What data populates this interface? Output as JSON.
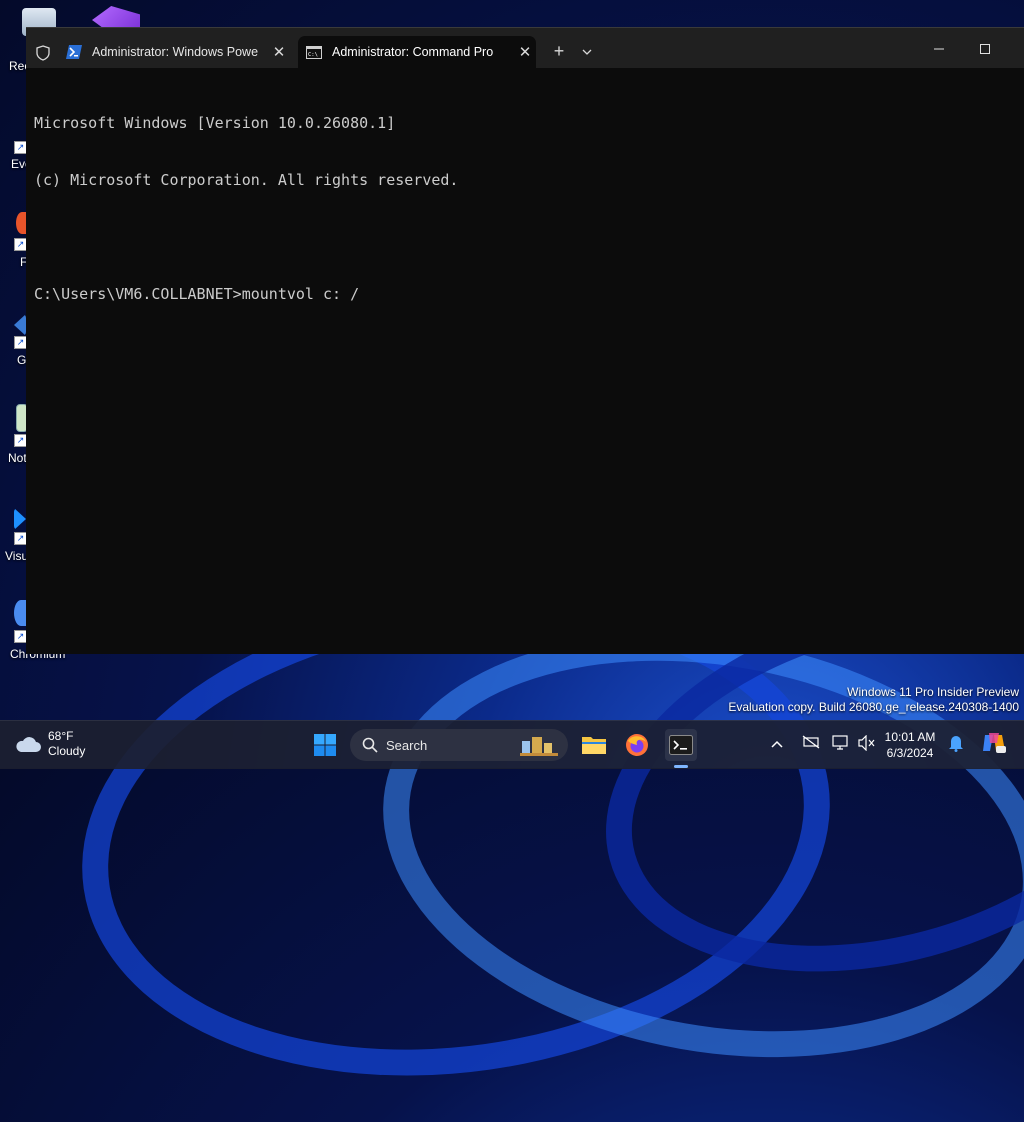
{
  "desktop": {
    "icons": [
      {
        "label": "Rec"
      },
      {
        "label": "Eve"
      },
      {
        "label": "F"
      },
      {
        "label": "G"
      },
      {
        "label": "Not"
      },
      {
        "label": "Visu"
      },
      {
        "label": "Chromium"
      }
    ],
    "watermark": {
      "line1": "Windows 11 Pro Insider Preview",
      "line2": "Evaluation copy. Build 26080.ge_release.240308-1400"
    }
  },
  "terminal": {
    "tabs": [
      {
        "label": "Administrator: Windows Powe",
        "icon": "powershell-icon",
        "active": false
      },
      {
        "label": "Administrator: Command Pro",
        "icon": "cmd-icon",
        "active": true
      }
    ],
    "new_tab": "+",
    "dropdown": "⌄",
    "minimize": "─",
    "maximize": "☐",
    "console_lines": [
      "Microsoft Windows [Version 10.0.26080.1]",
      "(c) Microsoft Corporation. All rights reserved.",
      "",
      "C:\\Users\\VM6.COLLABNET>mountvol c: /"
    ]
  },
  "taskbar": {
    "weather": {
      "temp": "68°F",
      "condition": "Cloudy"
    },
    "search_placeholder": "Search",
    "pinned": [
      "start-icon",
      "file-explorer-icon",
      "firefox-icon",
      "terminal-icon"
    ],
    "tray": [
      "chevron-up-icon",
      "network-off-icon",
      "display-icon",
      "volume-muted-icon"
    ],
    "clock": {
      "time": "10:01 AM",
      "date": "6/3/2024"
    }
  }
}
